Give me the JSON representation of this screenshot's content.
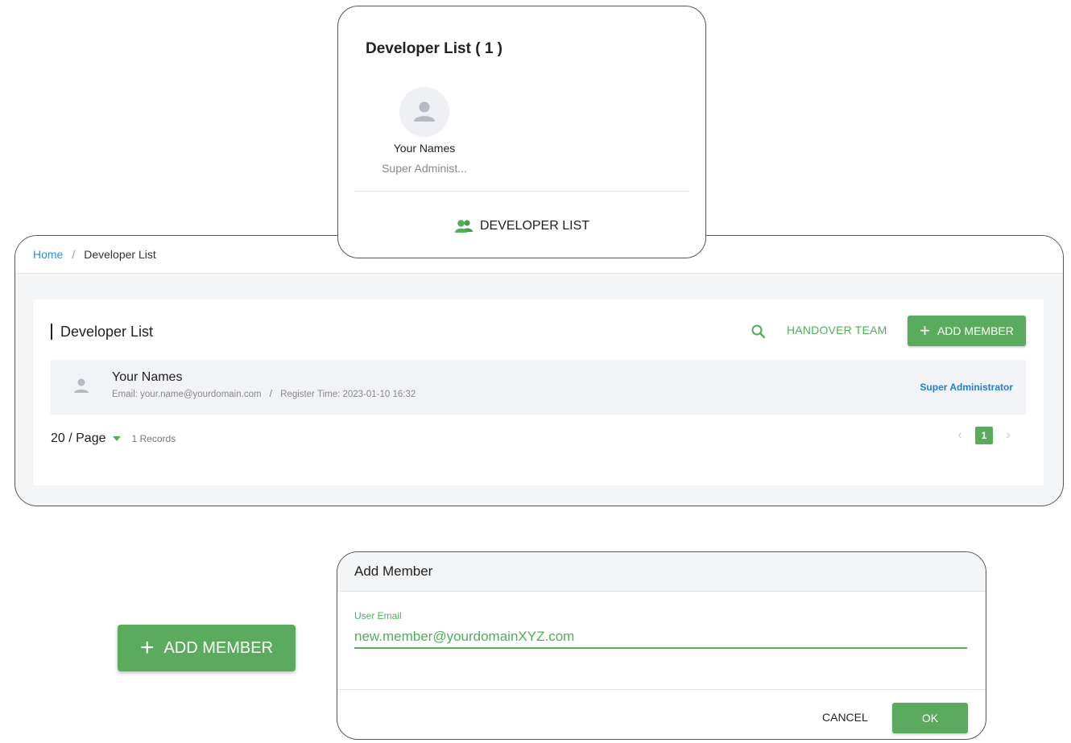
{
  "colors": {
    "accent": "#5aab5e",
    "link": "#2d8fd8",
    "role_link": "#1d7fd6",
    "panel_bg": "#f4f5f7"
  },
  "top_card": {
    "title": "Developer List ( 1 )",
    "developer": {
      "name": "Your Names",
      "role": "Super Administ..."
    },
    "footer_label": "DEVELOPER LIST",
    "footer_icon": "users-icon"
  },
  "breadcrumb": {
    "home": "Home",
    "separator": "/",
    "current": "Developer List"
  },
  "list": {
    "title": "Developer List",
    "search_icon": "search-icon",
    "handover_label": "HANDOVER TEAM",
    "add_label": "ADD MEMBER",
    "members": [
      {
        "name": "Your Names",
        "email_label": "Email:",
        "email": "your.name@yourdomain.com",
        "separator": "/",
        "register_label": "Register Time:",
        "register_time": "2023-01-10 16:32",
        "role": "Super Administrator"
      }
    ],
    "pagination": {
      "page_size": "20 / Page",
      "records": "1 Records",
      "current_page": "1",
      "prev": "‹",
      "next": "›"
    }
  },
  "big_button": {
    "label": "ADD MEMBER"
  },
  "dialog": {
    "title": "Add Member",
    "field_label": "User Email",
    "field_value": "new.member@yourdomainXYZ.com",
    "cancel_label": "CANCEL",
    "ok_label": "OK"
  }
}
